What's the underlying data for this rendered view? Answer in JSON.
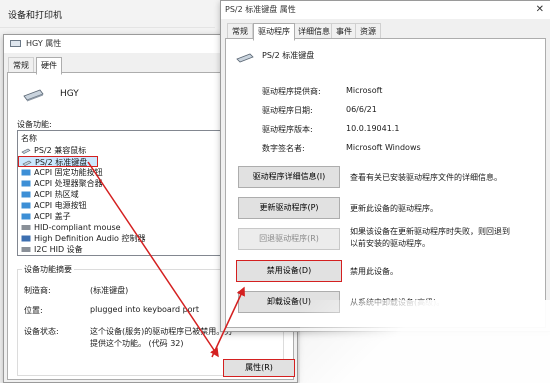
{
  "background": {
    "title": "设备和打印机"
  },
  "left_dialog": {
    "title": "HGY 属性",
    "tabs": [
      "常规",
      "硬件"
    ],
    "device_name": "HGY",
    "functions_label": "设备功能:",
    "column_header": "名称",
    "devices": [
      "PS/2 兼容鼠标",
      "PS/2 标准键盘",
      "ACPI 固定功能按钮",
      "ACPI 处理器聚合器",
      "ACPI 热区域",
      "ACPI 电源按钮",
      "ACPI 盖子",
      "HID-compliant mouse",
      "High Definition Audio 控制器",
      "I2C HID 设备"
    ],
    "summary_label": "设备功能摘要",
    "manufacturer_label": "制造商:",
    "manufacturer_value": "(标准键盘)",
    "location_label": "位置:",
    "location_value": "plugged into keyboard port",
    "status_label": "设备状态:",
    "status_line1": "这个设备(服务)的驱动程序已被禁用。另",
    "status_line2": "提供这个功能。 (代码 32)",
    "properties_button": "属性(R)"
  },
  "right_dialog": {
    "title": "PS/2 标准键盘 属性",
    "tabs": [
      "常规",
      "驱动程序",
      "详细信息",
      "事件",
      "资源"
    ],
    "device_name": "PS/2 标准键盘",
    "info": [
      {
        "label": "驱动程序提供商:",
        "value": "Microsoft"
      },
      {
        "label": "驱动程序日期:",
        "value": "06/6/21"
      },
      {
        "label": "驱动程序版本:",
        "value": "10.0.19041.1"
      },
      {
        "label": "数字签名者:",
        "value": "Microsoft Windows"
      }
    ],
    "actions": [
      {
        "button": "驱动程序详细信息(I)",
        "desc": [
          "查看有关已安装驱动程序文件的详细信息。"
        ]
      },
      {
        "button": "更新驱动程序(P)",
        "desc": [
          "更新此设备的驱动程序。"
        ]
      },
      {
        "button": "回退驱动程序(R)",
        "desc": [
          "如果该设备在更新驱动程序时失败，则回退到",
          "以前安装的驱动程序。"
        ]
      },
      {
        "button": "禁用设备(D)",
        "desc": [
          "禁用此设备。"
        ]
      },
      {
        "button": "卸载设备(U)",
        "desc": [
          "从系统中卸载设备(高级)。"
        ]
      }
    ]
  },
  "colors": {
    "annotation_red": "#d42020",
    "selection": "#cce8ff"
  }
}
